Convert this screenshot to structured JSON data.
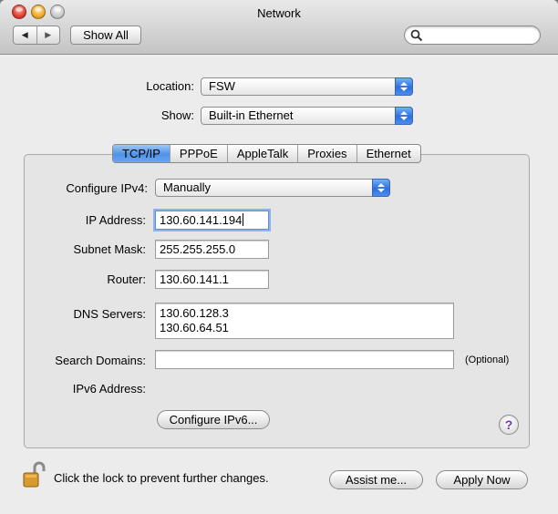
{
  "window": {
    "title": "Network"
  },
  "toolbar": {
    "back_icon": "◀",
    "forward_icon": "▶",
    "show_all_label": "Show All",
    "search_value": ""
  },
  "location": {
    "label": "Location:",
    "value": "FSW"
  },
  "show": {
    "label": "Show:",
    "value": "Built-in Ethernet"
  },
  "tabs": [
    {
      "label": "TCP/IP",
      "active": true
    },
    {
      "label": "PPPoE"
    },
    {
      "label": "AppleTalk"
    },
    {
      "label": "Proxies"
    },
    {
      "label": "Ethernet"
    }
  ],
  "tcpip": {
    "configure_ipv4_label": "Configure IPv4:",
    "configure_ipv4_value": "Manually",
    "ip_label": "IP Address:",
    "ip_value": "130.60.141.194",
    "subnet_label": "Subnet Mask:",
    "subnet_value": "255.255.255.0",
    "router_label": "Router:",
    "router_value": "130.60.141.1",
    "dns_label": "DNS Servers:",
    "dns_values": [
      "130.60.128.3",
      "130.60.64.51"
    ],
    "search_domains_label": "Search Domains:",
    "search_domains_value": "",
    "optional_label": "(Optional)",
    "ipv6_label": "IPv6 Address:",
    "configure_ipv6_button": "Configure IPv6...",
    "help_label": "?"
  },
  "footer": {
    "lock_text": "Click the lock to prevent further changes.",
    "assist_button": "Assist me...",
    "apply_button": "Apply Now"
  },
  "colors": {
    "accent": "#4f92e8",
    "window_bg": "#ececec"
  }
}
